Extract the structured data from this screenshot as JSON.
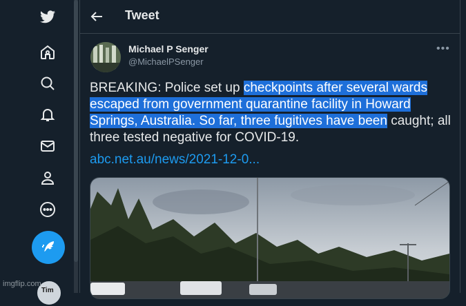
{
  "sidebar": {
    "items": [
      {
        "icon": "twitter-logo-icon"
      },
      {
        "icon": "home-icon"
      },
      {
        "icon": "search-icon"
      },
      {
        "icon": "notifications-icon"
      },
      {
        "icon": "messages-icon"
      },
      {
        "icon": "profile-icon"
      },
      {
        "icon": "more-icon"
      }
    ],
    "compose_icon": "compose-icon",
    "avatar_label": "Tim"
  },
  "header": {
    "title": "Tweet"
  },
  "tweet": {
    "author_name": "Michael P Senger",
    "author_handle": "@MichaelPSenger",
    "text_parts": {
      "plain_1": "BREAKING: Police set up ",
      "highlight": "checkpoints after several wards escaped from government quarantine facility in Howard Springs, Australia. So far, three fugitives have been",
      "plain_2": " caught; all three tested negative for COVID-19."
    },
    "link": "abc.net.au/news/2021-12-0..."
  },
  "watermark": "imgflip.com",
  "colors": {
    "background": "#15202b",
    "accent": "#1d9bf0",
    "highlight": "#1e6fd9"
  }
}
